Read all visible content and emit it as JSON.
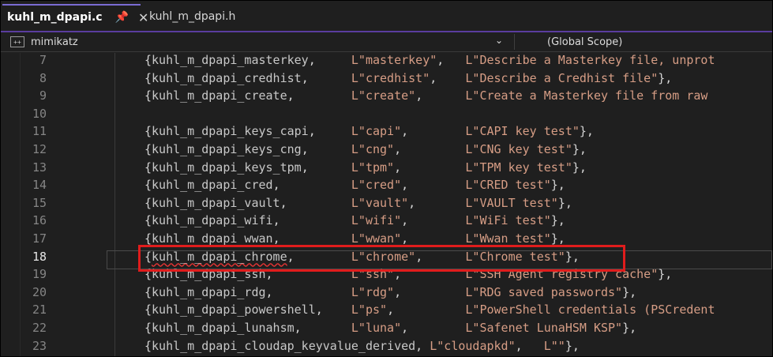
{
  "tabs": [
    {
      "label": "kuhl_m_dpapi.c",
      "active": true
    },
    {
      "label": "kuhl_m_dpapi.h",
      "active": false
    }
  ],
  "tab_icons": {
    "pin": "📌",
    "close": "✕"
  },
  "nav": {
    "project": "mimikatz",
    "project_icon": "++",
    "scope": "(Global Scope)",
    "chevron": "⌄"
  },
  "current_line": 18,
  "lines": [
    {
      "num": "7",
      "parts": [
        {
          "t": "{"
        },
        {
          "t": "kuhl_m_dpapi_masterkey",
          "c": "ident"
        },
        {
          "t": ",     "
        },
        {
          "t": "L\"masterkey\"",
          "c": "str"
        },
        {
          "t": ",   "
        },
        {
          "t": "L\"Describe a Masterkey file, unprot",
          "c": "str"
        }
      ]
    },
    {
      "num": "8",
      "parts": [
        {
          "t": "{"
        },
        {
          "t": "kuhl_m_dpapi_credhist",
          "c": "ident"
        },
        {
          "t": ",      "
        },
        {
          "t": "L\"credhist\"",
          "c": "str"
        },
        {
          "t": ",    "
        },
        {
          "t": "L\"Describe a Credhist file\"",
          "c": "str"
        },
        {
          "t": "},"
        }
      ]
    },
    {
      "num": "9",
      "parts": [
        {
          "t": "{"
        },
        {
          "t": "kuhl_m_dpapi_create",
          "c": "ident"
        },
        {
          "t": ",        "
        },
        {
          "t": "L\"create\"",
          "c": "str"
        },
        {
          "t": ",      "
        },
        {
          "t": "L\"Create a Masterkey file from raw",
          "c": "str"
        }
      ]
    },
    {
      "num": "10",
      "parts": []
    },
    {
      "num": "11",
      "parts": [
        {
          "t": "{"
        },
        {
          "t": "kuhl_m_dpapi_keys_capi",
          "c": "ident"
        },
        {
          "t": ",     "
        },
        {
          "t": "L\"capi\"",
          "c": "str"
        },
        {
          "t": ",        "
        },
        {
          "t": "L\"CAPI key test\"",
          "c": "str"
        },
        {
          "t": "},"
        }
      ]
    },
    {
      "num": "12",
      "parts": [
        {
          "t": "{"
        },
        {
          "t": "kuhl_m_dpapi_keys_cng",
          "c": "ident"
        },
        {
          "t": ",      "
        },
        {
          "t": "L\"cng\"",
          "c": "str"
        },
        {
          "t": ",         "
        },
        {
          "t": "L\"CNG key test\"",
          "c": "str"
        },
        {
          "t": "},"
        }
      ]
    },
    {
      "num": "13",
      "parts": [
        {
          "t": "{"
        },
        {
          "t": "kuhl_m_dpapi_keys_tpm",
          "c": "ident"
        },
        {
          "t": ",      "
        },
        {
          "t": "L\"tpm\"",
          "c": "str"
        },
        {
          "t": ",         "
        },
        {
          "t": "L\"TPM key test\"",
          "c": "str"
        },
        {
          "t": "},"
        }
      ]
    },
    {
      "num": "14",
      "parts": [
        {
          "t": "{"
        },
        {
          "t": "kuhl_m_dpapi_cred",
          "c": "ident"
        },
        {
          "t": ",          "
        },
        {
          "t": "L\"cred\"",
          "c": "str"
        },
        {
          "t": ",        "
        },
        {
          "t": "L\"CRED test\"",
          "c": "str"
        },
        {
          "t": "},"
        }
      ]
    },
    {
      "num": "15",
      "parts": [
        {
          "t": "{"
        },
        {
          "t": "kuhl_m_dpapi_vault",
          "c": "ident"
        },
        {
          "t": ",         "
        },
        {
          "t": "L\"vault\"",
          "c": "str"
        },
        {
          "t": ",       "
        },
        {
          "t": "L\"VAULT test\"",
          "c": "str"
        },
        {
          "t": "},"
        }
      ]
    },
    {
      "num": "16",
      "parts": [
        {
          "t": "{"
        },
        {
          "t": "kuhl_m_dpapi_wifi",
          "c": "ident"
        },
        {
          "t": ",          "
        },
        {
          "t": "L\"wifi\"",
          "c": "str"
        },
        {
          "t": ",        "
        },
        {
          "t": "L\"WiFi test\"",
          "c": "str"
        },
        {
          "t": "},"
        }
      ]
    },
    {
      "num": "17",
      "parts": [
        {
          "t": "{"
        },
        {
          "t": "kuhl_m_dpapi_wwan",
          "c": "ident"
        },
        {
          "t": ",          "
        },
        {
          "t": "L\"wwan\"",
          "c": "str"
        },
        {
          "t": ",        "
        },
        {
          "t": "L\"Wwan test\"",
          "c": "str"
        },
        {
          "t": "},"
        }
      ]
    },
    {
      "num": "18",
      "parts": [
        {
          "t": "{"
        },
        {
          "t": "kuhl_m_dpapi_chrome",
          "c": "ident squig"
        },
        {
          "t": ",        "
        },
        {
          "t": "L\"chrome\"",
          "c": "str"
        },
        {
          "t": ",      "
        },
        {
          "t": "L\"Chrome test\"",
          "c": "str"
        },
        {
          "t": "},"
        }
      ]
    },
    {
      "num": "19",
      "parts": [
        {
          "t": "{"
        },
        {
          "t": "kuhl_m_dpapi_ssh",
          "c": "ident"
        },
        {
          "t": ",           "
        },
        {
          "t": "L\"ssh\"",
          "c": "str"
        },
        {
          "t": ",         "
        },
        {
          "t": "L\"SSH Agent registry cache\"",
          "c": "str"
        },
        {
          "t": "},"
        }
      ]
    },
    {
      "num": "20",
      "parts": [
        {
          "t": "{"
        },
        {
          "t": "kuhl_m_dpapi_rdg",
          "c": "ident"
        },
        {
          "t": ",           "
        },
        {
          "t": "L\"rdg\"",
          "c": "str"
        },
        {
          "t": ",         "
        },
        {
          "t": "L\"RDG saved passwords\"",
          "c": "str"
        },
        {
          "t": "},"
        }
      ]
    },
    {
      "num": "21",
      "parts": [
        {
          "t": "{"
        },
        {
          "t": "kuhl_m_dpapi_powershell",
          "c": "ident"
        },
        {
          "t": ",    "
        },
        {
          "t": "L\"ps\"",
          "c": "str"
        },
        {
          "t": ",          "
        },
        {
          "t": "L\"PowerShell credentials (PSCredent",
          "c": "str"
        }
      ]
    },
    {
      "num": "22",
      "parts": [
        {
          "t": "{"
        },
        {
          "t": "kuhl_m_dpapi_lunahsm",
          "c": "ident"
        },
        {
          "t": ",       "
        },
        {
          "t": "L\"luna\"",
          "c": "str"
        },
        {
          "t": ",        "
        },
        {
          "t": "L\"Safenet LunaHSM KSP\"",
          "c": "str"
        },
        {
          "t": "},"
        }
      ]
    },
    {
      "num": "23",
      "parts": [
        {
          "t": "{"
        },
        {
          "t": "kuhl_m_dpapi_cloudap_keyvalue_derived",
          "c": "ident"
        },
        {
          "t": ", "
        },
        {
          "t": "L\"cloudapkd\"",
          "c": "str"
        },
        {
          "t": ",   "
        },
        {
          "t": "L\"\"",
          "c": "str"
        },
        {
          "t": "},"
        }
      ]
    }
  ]
}
